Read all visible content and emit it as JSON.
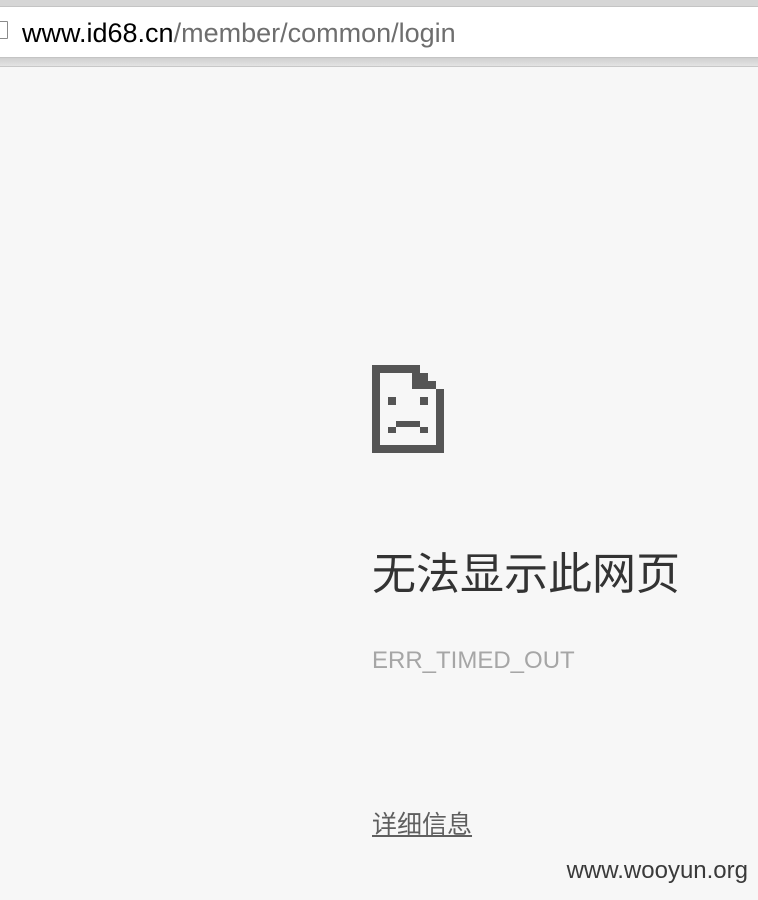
{
  "address_bar": {
    "url_host": "www.id68.cn",
    "url_path": "/member/common/login"
  },
  "error_page": {
    "icon": "sad-page-icon",
    "title": "无法显示此网页",
    "error_code": "ERR_TIMED_OUT",
    "details_link": "详细信息"
  },
  "watermark": "www.wooyun.org",
  "colors": {
    "page_background": "#f7f7f7",
    "title": "#333333",
    "error_code": "#a6a6a6",
    "link": "#5f5f5f",
    "icon": "#555555"
  }
}
